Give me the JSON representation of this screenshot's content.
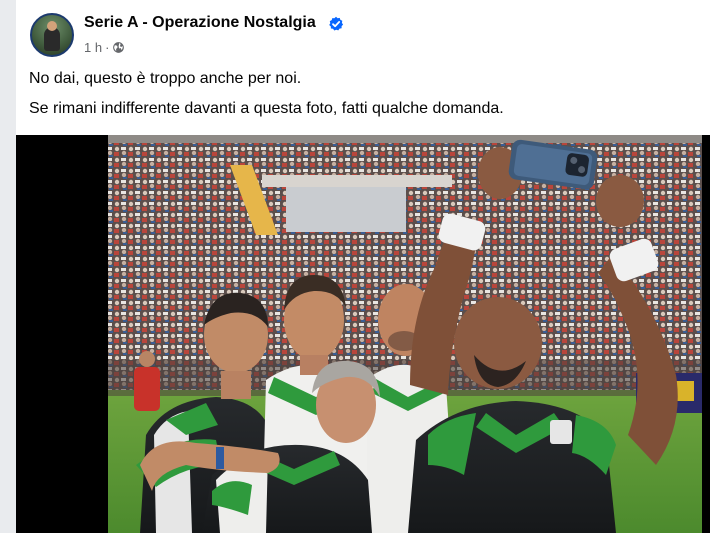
{
  "post": {
    "page_name": "Serie A - Operazione Nostalgia",
    "time": "1 h",
    "separator": "·",
    "text_line1": "No dai, questo è troppo anche per noi.",
    "text_line2": "Se rimani indifferente davanti a questa foto, fatti qualche domanda."
  },
  "icons": {
    "verified": "verified-badge-icon",
    "audience": "globe-icon"
  },
  "colors": {
    "verified_blue": "#0866ff",
    "text": "#050505",
    "secondary_text": "#65676b"
  }
}
